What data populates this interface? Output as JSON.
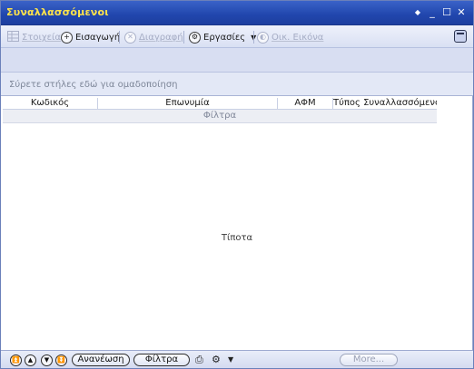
{
  "window": {
    "title": "Συναλλασσόμενοι",
    "controls": {
      "pin": "◆",
      "minimize": "_",
      "maximize": "☐",
      "close": "✕"
    }
  },
  "toolbar": {
    "details": "Στοιχεία",
    "insert": "Εισαγωγή",
    "delete": "Διαγραφή",
    "tasks": "Εργασίες",
    "image": "Οικ. Εικόνα"
  },
  "group_hint": "Σύρετε στήλες εδώ για ομαδοποίηση",
  "grid": {
    "columns": [
      "Κωδικός",
      "Επωνυμία",
      "ΑΦΜ",
      "Τύπος Συναλλασσόμενου"
    ],
    "filter_label": "Φίλτρα",
    "empty_text": "Τίποτα"
  },
  "statusbar": {
    "refresh": "Ανανέωση",
    "filters": "Φίλτρα",
    "more": "More..."
  }
}
